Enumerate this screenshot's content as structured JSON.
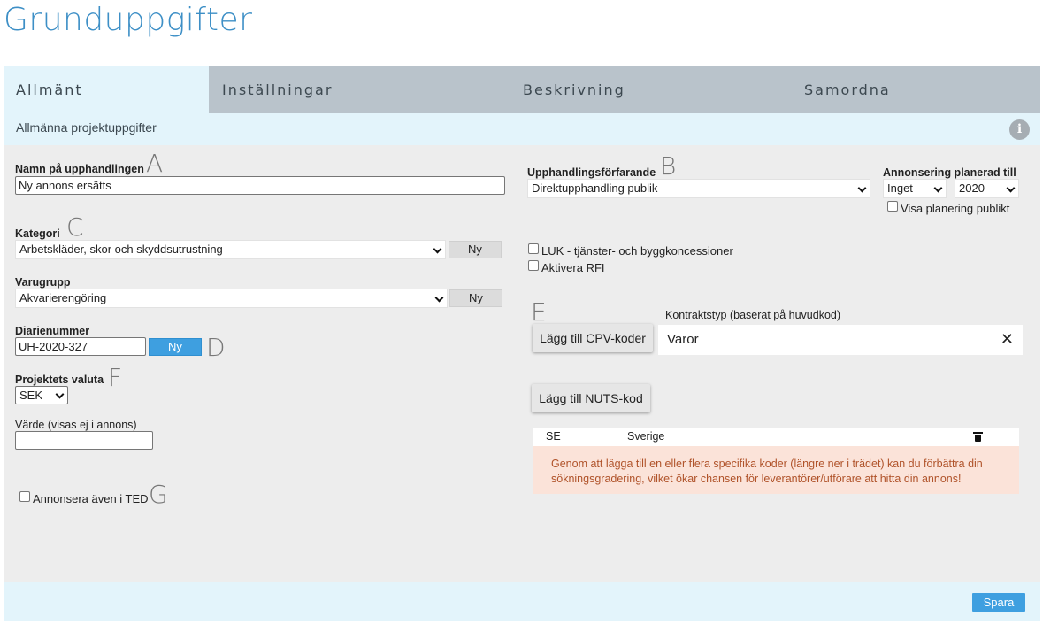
{
  "page": {
    "title": "Grunduppgifter"
  },
  "tabs": [
    {
      "label": "Allmänt",
      "active": true
    },
    {
      "label": "Inställningar",
      "active": false
    },
    {
      "label": "Beskrivning",
      "active": false
    },
    {
      "label": "Samordna",
      "active": false
    }
  ],
  "section": {
    "title": "Allmänna projektuppgifter",
    "info_icon": "i"
  },
  "form": {
    "name": {
      "label": "Namn på upphandlingen",
      "value": "Ny annons ersätts",
      "annotation": "A"
    },
    "category": {
      "label": "Kategori",
      "value": "Arbetskläder, skor och skyddsutrustning",
      "new_button": "Ny",
      "annotation": "C"
    },
    "product_group": {
      "label": "Varugrupp",
      "value": "Akvarierengöring",
      "new_button": "Ny"
    },
    "diary": {
      "label": "Diarienummer",
      "value": "UH-2020-327",
      "new_button": "Ny",
      "annotation": "D"
    },
    "currency": {
      "label": "Projektets valuta",
      "value": "SEK",
      "annotation": "F"
    },
    "amount": {
      "label": "Värde (visas ej i annons)",
      "value": ""
    },
    "ted": {
      "label": "Annonsera även i TED",
      "checked": false,
      "annotation": "G"
    },
    "procedure": {
      "label": "Upphandlingsförfarande",
      "value": "Direktupphandling publik",
      "annotation": "B"
    },
    "announcement": {
      "label": "Annonsering planerad till",
      "period": "Inget",
      "year": "2020",
      "public_label": "Visa planering publikt",
      "public_checked": false
    },
    "luk": {
      "label": "LUK - tjänster- och byggkoncessioner",
      "checked": false
    },
    "rfi": {
      "label": "Aktivera RFI",
      "checked": false
    },
    "cpv": {
      "annotation": "E",
      "button": "Lägg till CPV-koder",
      "contract_type_label": "Kontraktstyp (baserat på huvudkod)",
      "contract_type_value": "Varor"
    },
    "nuts": {
      "button": "Lägg till NUTS-kod",
      "rows": [
        {
          "code": "SE",
          "name": "Sverige"
        }
      ],
      "hint": "Genom att lägga till en eller flera specifika koder (längre ner i trädet) kan du förbättra din sökningsgradering, vilket ökar chansen för leverantörer/utförare att hitta din annons!"
    }
  },
  "footer": {
    "save_button": "Spara"
  },
  "colors": {
    "accent": "#3e9fe0",
    "title": "#3d8fc6",
    "tab_bar": "#b9c3cb",
    "light_blue": "#e3f4fb",
    "panel": "#ededed",
    "hint_bg": "#fbe3d9",
    "hint_text": "#b0532a"
  }
}
